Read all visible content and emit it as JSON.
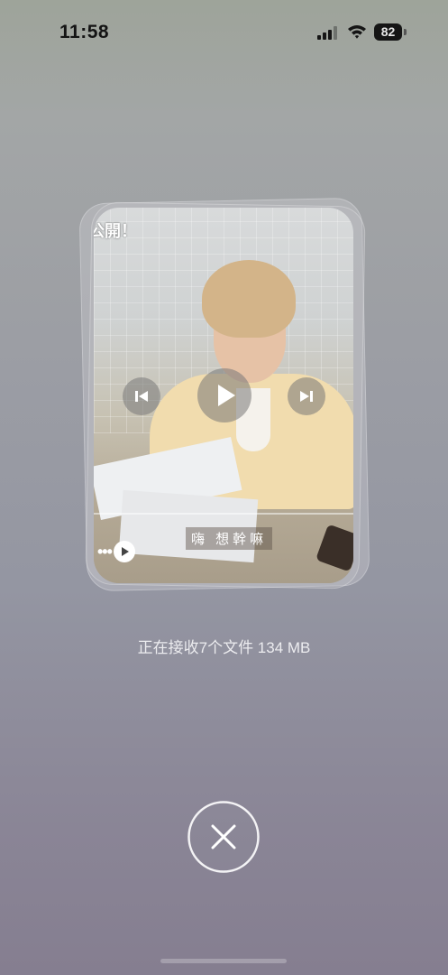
{
  "status_bar": {
    "time": "11:58",
    "battery_level": "82",
    "icons": [
      "signal-icon",
      "wifi-icon",
      "battery-icon"
    ]
  },
  "file_preview": {
    "overlay_text": "公開！",
    "subtitle": "嗨 想幹嘛",
    "controls": [
      "previous-icon",
      "play-icon",
      "next-icon",
      "more-dots-icon"
    ]
  },
  "transfer": {
    "status": "正在接收7个文件 134 MB"
  },
  "actions": {
    "cancel_icon": "close-icon",
    "ring_color": "#ffffff"
  }
}
